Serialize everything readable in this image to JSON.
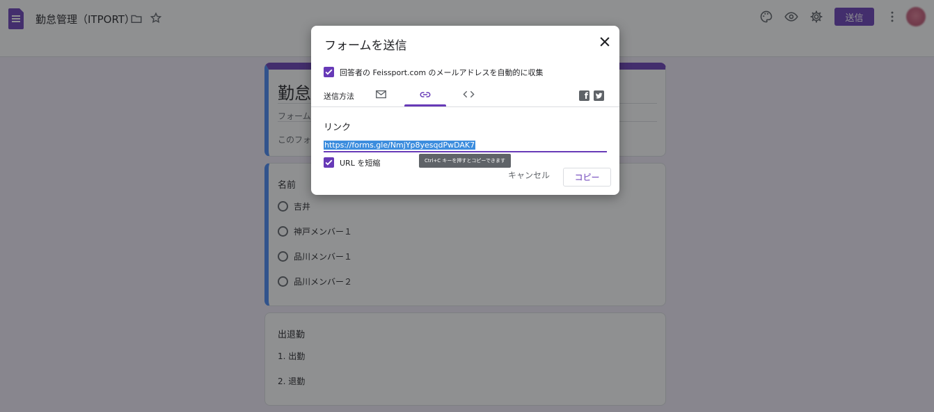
{
  "header": {
    "doc_title": "勤怠管理（ITPORT）",
    "send_label": "送信",
    "icons": [
      "forms-app-icon",
      "folder-icon",
      "star-icon",
      "palette-icon",
      "eye-icon",
      "gear-icon",
      "more-vert-icon",
      "avatar"
    ]
  },
  "form": {
    "title": "勤怠",
    "description": "フォームの",
    "note": "このフォー",
    "question1": {
      "title": "名前",
      "options": [
        "吉井",
        "神戸メンバー１",
        "品川メンバー１",
        "品川メンバー２"
      ]
    },
    "question2": {
      "title": "出退勤",
      "options": [
        "1.  出勤",
        "2.  退勤"
      ]
    }
  },
  "dialog": {
    "title": "フォームを送信",
    "collect_email_label": "回答者の Feissport.com のメールアドレスを自動的に収集",
    "collect_email_checked": true,
    "send_method_label": "送信方法",
    "tabs": [
      "mail-icon",
      "link-icon",
      "embed-icon"
    ],
    "active_tab": "link-icon",
    "link_heading": "リンク",
    "link_url": "https://forms.gle/NmjYp8yesqdPwDAK7",
    "shorten_label": "URL を短縮",
    "shorten_checked": true,
    "tooltip": "Ctrl+C キーを押すとコピーできます",
    "cancel_label": "キャンセル",
    "copy_label": "コピー"
  },
  "colors": {
    "accent": "#673ab7",
    "side_accent": "#4285f4",
    "selection": "#3c8dde"
  }
}
